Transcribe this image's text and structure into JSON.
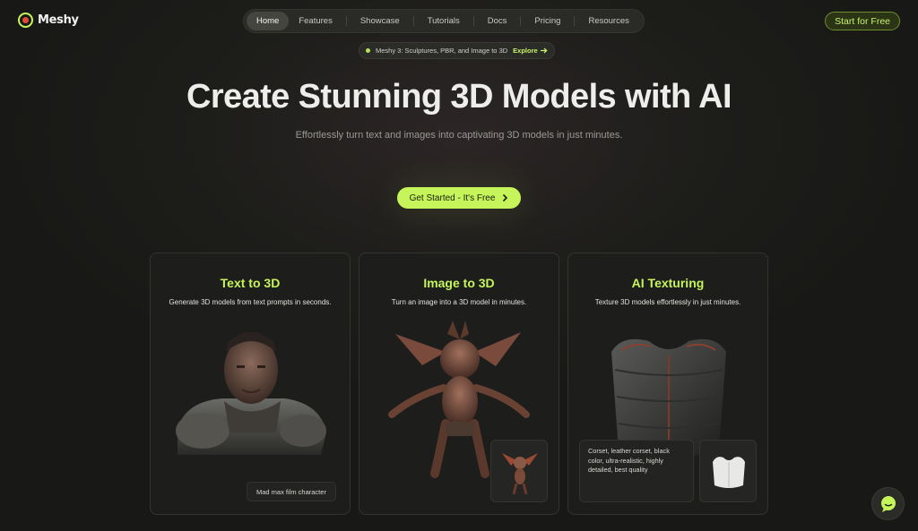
{
  "brand": {
    "name": "Meshy"
  },
  "nav": {
    "items": [
      {
        "label": "Home",
        "active": true
      },
      {
        "label": "Features"
      },
      {
        "label": "Showcase"
      },
      {
        "label": "Tutorials"
      },
      {
        "label": "Docs"
      },
      {
        "label": "Pricing"
      },
      {
        "label": "Resources"
      }
    ],
    "cta_label": "Start for Free"
  },
  "announcement": {
    "text": "Meshy 3: Sculptures, PBR, and Image to 3D",
    "link_label": "Explore"
  },
  "hero": {
    "title": "Create Stunning 3D Models with AI",
    "subtitle": "Effortlessly turn text and images into captivating 3D models in just minutes.",
    "cta_label": "Get Started - It's Free"
  },
  "cards": [
    {
      "title": "Text to 3D",
      "description": "Generate 3D models from text prompts in seconds.",
      "caption": "Mad max film character"
    },
    {
      "title": "Image to 3D",
      "description": "Turn an image into a 3D model in minutes."
    },
    {
      "title": "AI Texturing",
      "description": "Texture 3D models effortlessly in just minutes.",
      "prompt": "Corset, leather corset, black color, ultra-realistic, highly detailed, best quality"
    }
  ],
  "icons": {
    "chat": "chat-bubble-icon",
    "chevron": "chevron-right-icon",
    "arrow": "arrow-right-icon"
  },
  "colors": {
    "accent": "#c5f55a",
    "background": "#1c1c1a"
  }
}
